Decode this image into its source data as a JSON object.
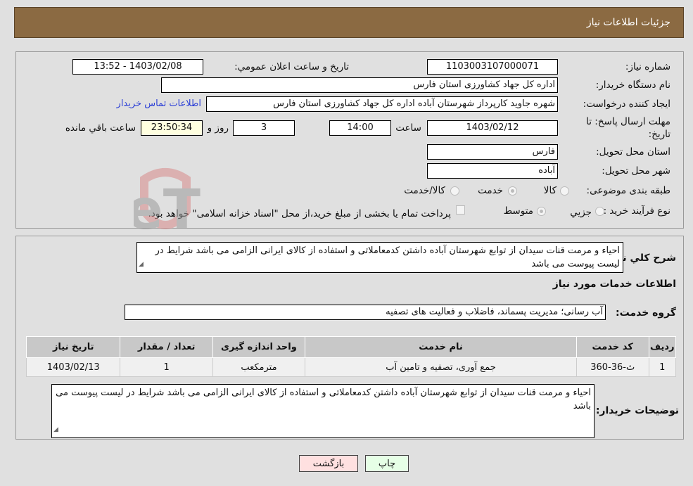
{
  "header": {
    "title": "جزئیات اطلاعات نیاز"
  },
  "form": {
    "need_number_label": "شماره نیاز:",
    "need_number": "1103003107000071",
    "announce_label": "تاریخ و ساعت اعلان عمومي:",
    "announce_value": "1403/02/08 - 13:52",
    "buyer_org_label": "نام دستگاه خریدار:",
    "buyer_org": "اداره کل جهاد کشاورزی استان فارس",
    "creator_label": "ایجاد کننده درخواست:",
    "creator": "شهره  جاوید  کارپرداز شهرستان آباده  اداره کل جهاد کشاورزی استان فارس",
    "contact_link": "اطلاعات تماس خریدار",
    "deadline_label_1": "مهلت ارسال پاسخ: تا",
    "deadline_label_2": "تاریخ:",
    "deadline_date": "1403/02/12",
    "time_label": "ساعت",
    "deadline_time": "14:00",
    "days": "3",
    "days_label": "روز و",
    "remaining": "23:50:34",
    "remaining_label": "ساعت باقي مانده",
    "province_label": "استان محل تحویل:",
    "province": "فارس",
    "city_label": "شهر محل تحویل:",
    "city": "آباده",
    "category_label": "طبقه بندی موضوعی:",
    "category_options": [
      {
        "label": "کالا",
        "checked": false
      },
      {
        "label": "خدمت",
        "checked": true
      },
      {
        "label": "کالا/خدمت",
        "checked": false
      }
    ],
    "process_label": "نوع فرآیند خرید :",
    "process_options": [
      {
        "label": "جزيي",
        "checked": false
      },
      {
        "label": "متوسط",
        "checked": true
      }
    ],
    "treasury_checkbox": "پرداخت تمام یا بخشی از مبلغ خرید،از محل \"اسناد خزانه اسلامی\" خواهد بود."
  },
  "details": {
    "description_label": "شرح کلي نیاز:",
    "description": "احیاء و مرمت قنات سیدان از توابع شهرستان آباده داشتن کدمعاملاتی و استفاده از کالای ایرانی الزامی می باشد شرایط در لیست پیوست می باشد",
    "services_title": "اطلاعات خدمات مورد نیاز",
    "service_group_label": "گروه خدمت:",
    "service_group": "آب رسانی؛ مدیریت پسماند، فاضلاب و فعالیت های تصفیه",
    "table": {
      "headers": [
        "ردیف",
        "کد خدمت",
        "نام خدمت",
        "واحد اندازه گیری",
        "تعداد / مقدار",
        "تاریخ نیاز"
      ],
      "rows": [
        [
          "1",
          "ث-36-360",
          "جمع آوری، تصفیه و تامین آب",
          "مترمکعب",
          "1",
          "1403/02/13"
        ]
      ]
    },
    "buyer_notes_label": "توضیحات خریدار:",
    "buyer_notes": "احیاء و مرمت قنات سیدان از توابع شهرستان آباده داشتن کدمعاملاتی و استفاده از کالای ایرانی الزامی می باشد شرایط در لیست پیوست می باشد"
  },
  "buttons": {
    "print": "چاپ",
    "back": "بازگشت"
  },
  "watermark": {
    "text": "AriaTender.neT"
  },
  "colors": {
    "header_bg": "#8b6a42",
    "link": "#2b3fd6",
    "print_bg": "#e6ffe6",
    "back_bg": "#ffe0e0"
  }
}
